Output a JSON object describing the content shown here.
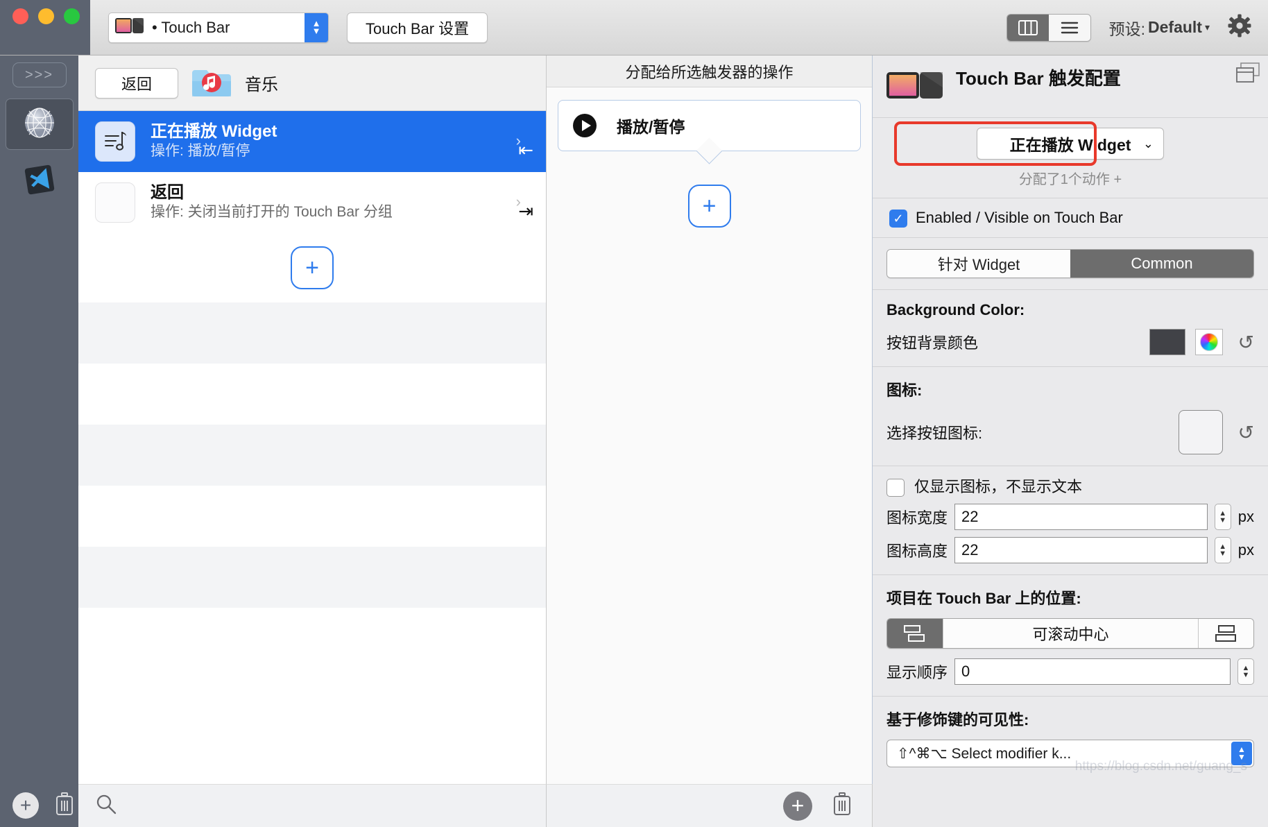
{
  "titlebar": {
    "device_combo_text": "• Touch Bar",
    "device_combo_icon": "touchbar-icon",
    "settings_button": "Touch Bar 设置",
    "view_mode_columns_icon": "columns-view-icon",
    "view_mode_list_icon": "list-view-icon",
    "preset_prefix": "预设:",
    "preset_value": "Default",
    "preset_caret": "▾",
    "gear_icon": "gear-icon"
  },
  "rail": {
    "terminal_button": ">>>",
    "items": [
      {
        "icon": "globe-app-icon",
        "selected": true
      },
      {
        "icon": "vscode-app-icon",
        "selected": false
      }
    ],
    "add_icon": "+",
    "delete_icon": "trash-icon"
  },
  "list_panel": {
    "back_button": "返回",
    "folder_icon": "music-folder-icon",
    "folder_name": "音乐",
    "rows": [
      {
        "title": "正在播放 Widget",
        "subtitle": "操作: 播放/暂停",
        "icon": "music-note-list-icon",
        "selected": true,
        "chevron": "›",
        "arrow_glyph": "⇤"
      },
      {
        "title": "返回",
        "subtitle": "操作: 关闭当前打开的 Touch Bar 分组",
        "icon": "blank-icon",
        "selected": false,
        "chevron": "›",
        "arrow_glyph": "⇥"
      }
    ],
    "add_row_button": "+",
    "search_icon": "search-icon",
    "footer_add_icon": "+",
    "footer_delete_icon": "trash-icon"
  },
  "action_panel": {
    "header": "分配给所选触发器的操作",
    "cards": [
      {
        "icon": "play-pause-icon",
        "label": "播放/暂停"
      }
    ],
    "add_button": "+",
    "footer_add_icon": "+",
    "footer_delete_icon": "trash-icon"
  },
  "inspector": {
    "icon": "touchbar-icon",
    "title": "Touch Bar 触发配置",
    "window_icon": "window-icon",
    "selected_widget": "正在播放 Widget",
    "selected_widget_caret": "⌄",
    "assigned_actions": "分配了1个动作 +",
    "enabled_checkbox": {
      "label": "Enabled / Visible on Touch Bar",
      "checked": true,
      "check_glyph": "✓"
    },
    "tabs": [
      {
        "label": "针对 Widget",
        "active": false
      },
      {
        "label": "Common",
        "active": true
      }
    ],
    "background_color": {
      "section_label": "Background Color:",
      "row_label": "按钮背景颜色",
      "swatch_hex": "#414247",
      "color_wheel_icon": "color-wheel-icon",
      "reset_icon": "reset-icon"
    },
    "icon_section": {
      "section_label": "图标:",
      "row_label": "选择按钮图标:",
      "reset_icon": "reset-icon"
    },
    "icon_only_checkbox": {
      "label": "仅显示图标，不显示文本",
      "checked": false
    },
    "icon_width": {
      "label": "图标宽度",
      "value": "22",
      "unit": "px"
    },
    "icon_height": {
      "label": "图标高度",
      "value": "22",
      "unit": "px"
    },
    "position_section": {
      "label": "项目在 Touch Bar 上的位置:",
      "options": [
        {
          "label": "",
          "icon": "align-left-icon",
          "active": true
        },
        {
          "label": "可滚动中心",
          "icon": "",
          "active": false
        },
        {
          "label": "",
          "icon": "align-right-icon",
          "active": false
        }
      ],
      "order_label": "显示顺序",
      "order_value": "0"
    },
    "modifier_section": {
      "label": "基于修饰键的可见性:",
      "field_value": "⇧^⌘⌥ Select modifier k..."
    }
  },
  "watermark": "https://blog.csdn.net/guang_s"
}
